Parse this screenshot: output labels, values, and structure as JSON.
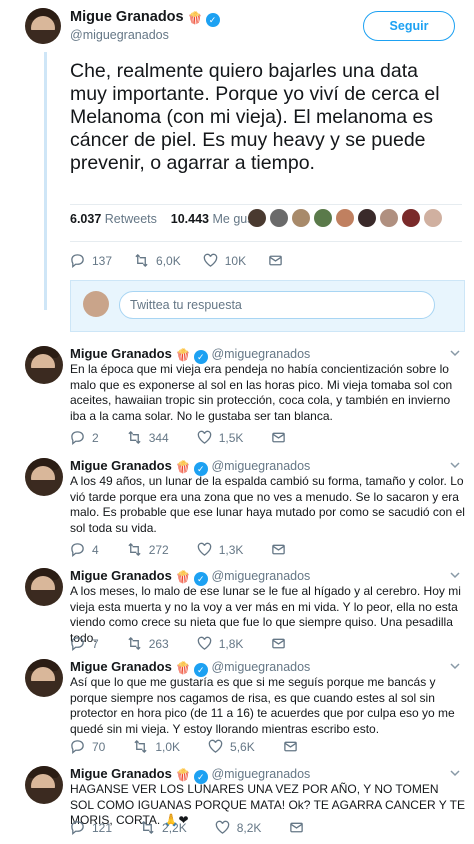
{
  "author": {
    "name": "Migue Granados",
    "handle": "@miguegranados",
    "verified_mark": "✓",
    "popcorn_icon": "popcorn-icon"
  },
  "follow_label": "Seguir",
  "main_tweet": {
    "text": "Che, realmente quiero bajarles una data muy importante. Porque yo viví de cerca el Melanoma (con mi vieja). El melanoma es cáncer de piel. Es muy heavy y se puede prevenir, o agarrar a tiempo.",
    "retweets_count": "6.037",
    "retweets_label": "Retweets",
    "likes_count": "10.443",
    "likes_label": "Me gusta",
    "actions": {
      "reply": "137",
      "retweet": "6,0K",
      "like": "10K"
    }
  },
  "reply_placeholder": "Twittea tu respuesta",
  "thread": [
    {
      "text": "En la época que mi vieja era pendeja no había concientización sobre lo malo que es exponerse al sol en las horas pico. Mi vieja tomaba sol con aceites, hawaiian tropic sin protección, coca cola, y también en invierno iba a la cama solar. No le gustaba ser tan blanca.",
      "reply": "2",
      "retweet": "344",
      "like": "1,5K"
    },
    {
      "text": "A los 49 años, un lunar de la espalda cambió su forma, tamaño y color. Lo vió tarde porque era una zona que no ves a menudo. Se lo sacaron y era malo. Es probable que ese lunar haya mutado por como se sacudió con el sol toda su vida.",
      "reply": "4",
      "retweet": "272",
      "like": "1,3K"
    },
    {
      "text": "A los meses, lo malo de ese lunar se le fue al hígado y al cerebro. Hoy mi vieja esta muerta y no la voy a ver más en mi vida. Y lo peor, ella no esta viendo como crece su nieta que fue lo que siempre quiso. Una pesadilla todo.",
      "reply": "7",
      "retweet": "263",
      "like": "1,8K"
    },
    {
      "text": "Así que lo que me gustaría es que si me seguís porque me bancás y porque siempre nos cagamos de risa, es que cuando estes al sol sin protector en hora pico (de 11 a 16) te acuerdes que por culpa eso yo me quedé sin mi vieja. Y estoy llorando mientras escribo esto.",
      "reply": "70",
      "retweet": "1,0K",
      "like": "5,6K"
    },
    {
      "text": "HAGANSE VER LOS LUNARES UNA VEZ POR AÑO, Y NO TOMEN SOL COMO IGUANAS PORQUE MATA! Ok? TE AGARRA CANCER Y TE MORIS, CORTA. 🙏❤",
      "reply": "121",
      "retweet": "2,2K",
      "like": "8,2K"
    }
  ],
  "colors": {
    "accent": "#1da1f2",
    "muted": "#657786",
    "text": "#14171a"
  }
}
